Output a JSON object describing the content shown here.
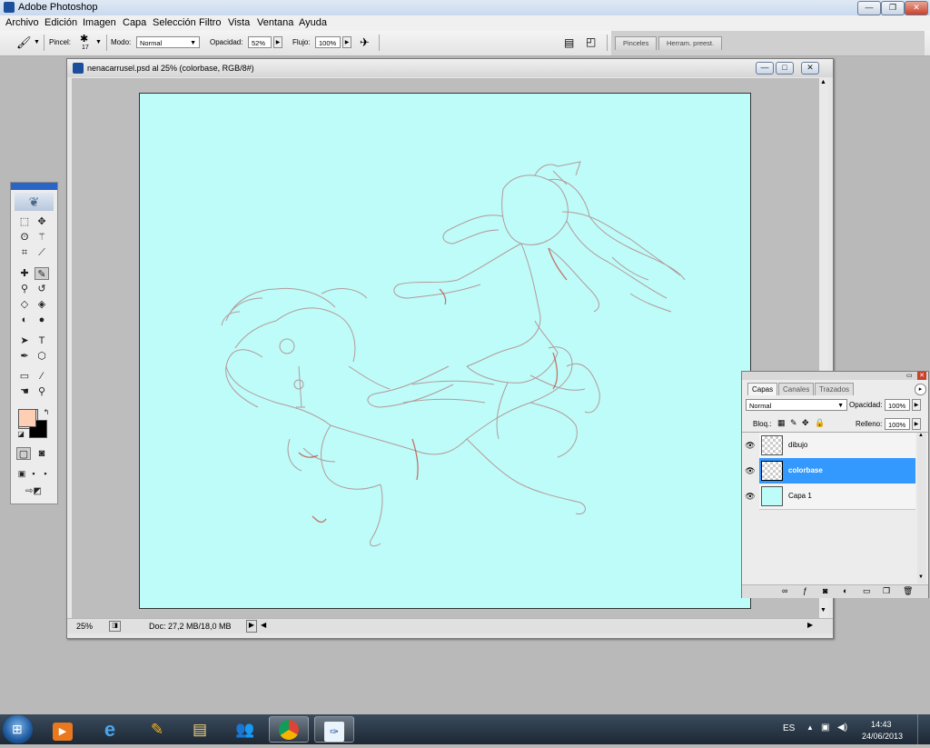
{
  "app": {
    "title": "Adobe Photoshop"
  },
  "menu": [
    "Archivo",
    "Edición",
    "Imagen",
    "Capa",
    "Selección",
    "Filtro",
    "Vista",
    "Ventana",
    "Ayuda"
  ],
  "options": {
    "brush_label": "Pincel:",
    "brush_size": "17",
    "mode_label": "Modo:",
    "mode_value": "Normal",
    "opacity_label": "Opacidad:",
    "opacity_value": "52%",
    "flow_label": "Flujo:",
    "flow_value": "100%",
    "well_tabs": [
      "Pinceles",
      "Herram. preest."
    ]
  },
  "document": {
    "title": "nenacarrusel.psd al 25% (colorbase, RGB/8#)",
    "zoom": "25%",
    "doc_info": "Doc: 27,2 MB/18,0 MB",
    "canvas_color": "#bdfcf9",
    "line_color": "#b88a8a"
  },
  "layers_panel": {
    "tabs": [
      "Capas",
      "Canales",
      "Trazados"
    ],
    "blend_mode": "Normal",
    "opacity_label": "Opacidad:",
    "opacity_value": "100%",
    "lock_label": "Bloq.:",
    "fill_label": "Relleno:",
    "fill_value": "100%",
    "layers": [
      {
        "name": "dibujo",
        "selected": false
      },
      {
        "name": "colorbase",
        "selected": true
      },
      {
        "name": "Capa 1",
        "selected": false
      }
    ]
  },
  "toolbox": {
    "foreground": "#ffcfb5",
    "background": "#000000"
  },
  "taskbar": {
    "lang": "ES",
    "time": "14:43",
    "date": "24/06/2013",
    "apps": [
      "start",
      "media-player",
      "internet-explorer",
      "live-messenger",
      "explorer",
      "network",
      "chrome",
      "photoshop"
    ]
  }
}
